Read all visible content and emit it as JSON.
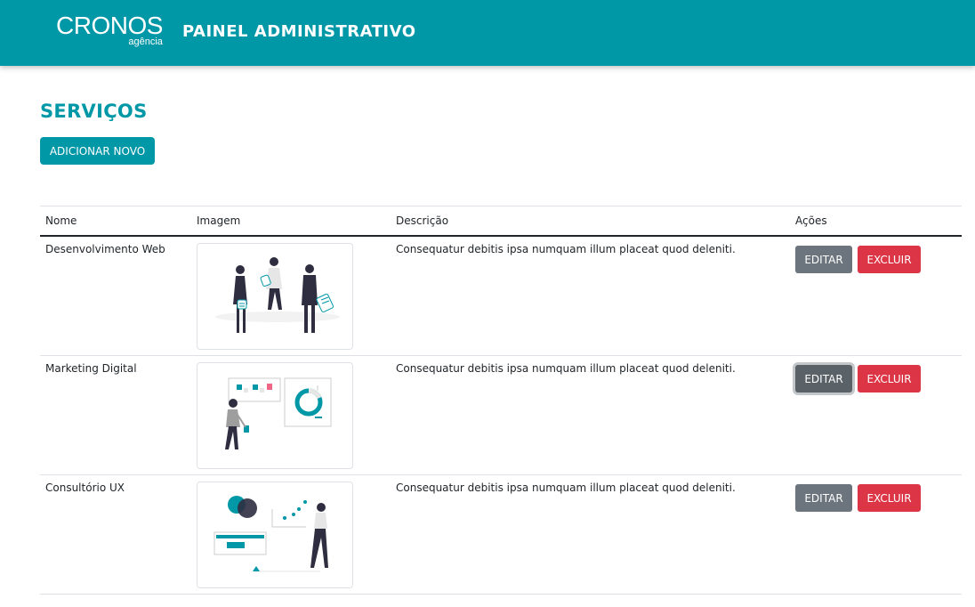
{
  "header": {
    "brand_name": "CRONOS",
    "brand_sub": "agência",
    "panel_title": "PAINEL ADMINISTRATIVO"
  },
  "page": {
    "title": "SERVIÇOS",
    "add_button": "ADICIONAR NOVO"
  },
  "table": {
    "headers": [
      "Nome",
      "Imagem",
      "Descrição",
      "Ações"
    ],
    "rows": [
      {
        "name": "Desenvolvimento Web",
        "image": "team-people-illustration",
        "description": "Consequatur debitis ipsa numquam illum placeat quod deleniti.",
        "edit": "EDITAR",
        "delete": "EXCLUIR"
      },
      {
        "name": "Marketing Digital",
        "image": "analytics-board-illustration",
        "description": "Consequatur debitis ipsa numquam illum placeat quod deleniti.",
        "edit": "EDITAR",
        "delete": "EXCLUIR"
      },
      {
        "name": "Consultório UX",
        "image": "ux-charts-illustration",
        "description": "Consequatur debitis ipsa numquam illum placeat quod deleniti.",
        "edit": "EDITAR",
        "delete": "EXCLUIR"
      }
    ]
  },
  "colors": {
    "primary": "#0097a7",
    "secondary": "#6c757d",
    "danger": "#dc3545",
    "illustration_dark": "#2f2e41",
    "illustration_accent": "#0097a7",
    "illustration_pink": "#f06585"
  }
}
